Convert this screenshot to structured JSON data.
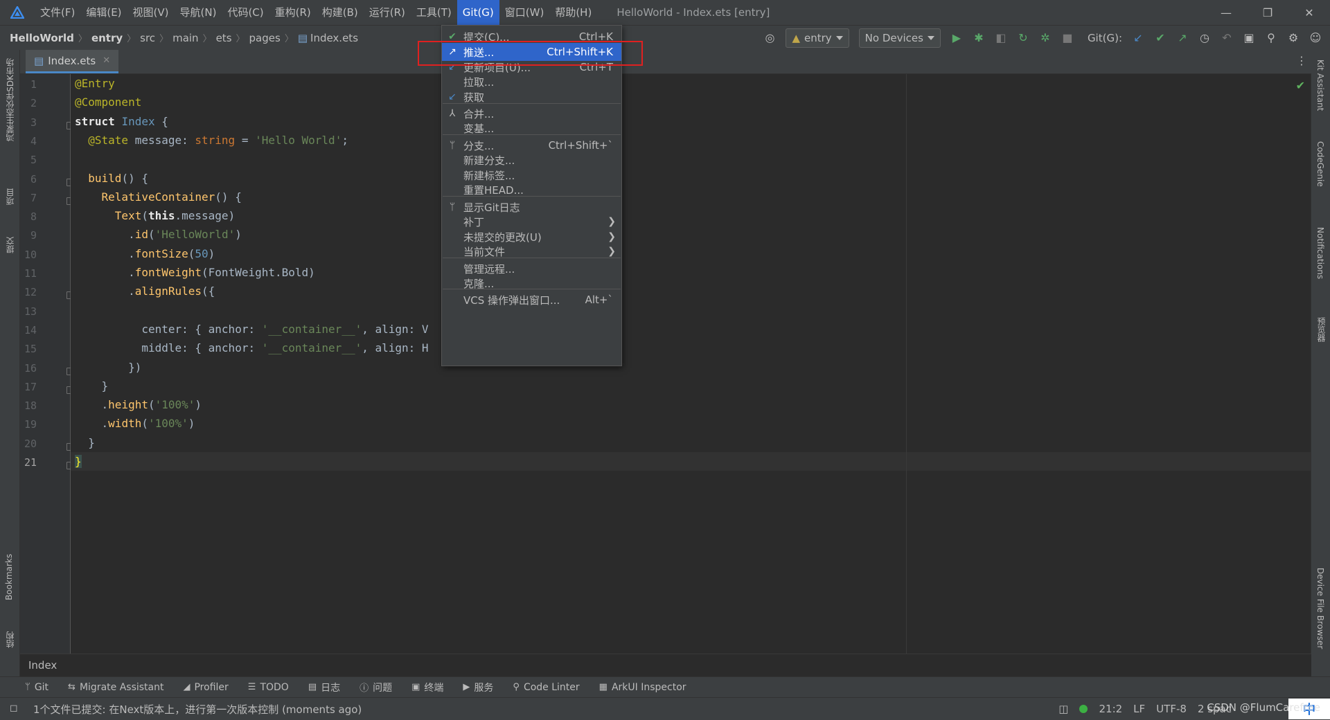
{
  "menubar": {
    "items": [
      "文件(F)",
      "编辑(E)",
      "视图(V)",
      "导航(N)",
      "代码(C)",
      "重构(R)",
      "构建(B)",
      "运行(R)",
      "工具(T)",
      "Git(G)",
      "窗口(W)",
      "帮助(H)"
    ],
    "window_title": "HelloWorld - Index.ets [entry]"
  },
  "breadcrumb": [
    "HelloWorld",
    "entry",
    "src",
    "main",
    "ets",
    "pages",
    "Index.ets"
  ],
  "toolbar": {
    "module_combo": "entry",
    "device_combo": "No Devices",
    "git_label": "Git(G):"
  },
  "tab": {
    "label": "Index.ets"
  },
  "left_stripe": {
    "labels": [
      "鸿蒙生态伙伴SDK市场",
      "项目",
      "提交",
      "Bookmarks",
      "结构"
    ]
  },
  "right_stripe": {
    "labels": [
      "Kit Assistant",
      "CodeGenie",
      "Notifications",
      "预览器",
      "Device File Browser"
    ]
  },
  "editor": {
    "line_numbers": [
      "1",
      "2",
      "3",
      "4",
      "5",
      "6",
      "7",
      "8",
      "9",
      "10",
      "11",
      "12",
      "13",
      "14",
      "15",
      "16",
      "17",
      "18",
      "19",
      "20",
      "21"
    ],
    "current_line": 21,
    "code": [
      "@Entry",
      "@Component",
      "struct Index {",
      "  @State message: string = 'Hello World';",
      "",
      "  build() {",
      "    RelativeContainer() {",
      "      Text(this.message)",
      "        .id('HelloWorld')",
      "        .fontSize(50)",
      "        .fontWeight(FontWeight.Bold)",
      "        .alignRules({",
      "",
      "          center: { anchor: '__container__', align: V",
      "          middle: { anchor: '__container__', align: H",
      "        })",
      "    }",
      "    .height('100%')",
      "    .width('100%')",
      "  }",
      "}"
    ],
    "footer_crumb": "Index"
  },
  "git_menu": {
    "items": [
      {
        "icon": "check-icon",
        "label": "提交(C)...",
        "shortcut": "Ctrl+K"
      },
      {
        "icon": "push-arrow-icon",
        "label": "推送...",
        "shortcut": "Ctrl+Shift+K",
        "selected": true
      },
      {
        "icon": "update-arrow-icon",
        "label": "更新项目(U)...",
        "shortcut": "Ctrl+T"
      },
      {
        "icon": "",
        "label": "拉取...",
        "shortcut": ""
      },
      {
        "icon": "fetch-arrow-icon",
        "label": "获取",
        "shortcut": ""
      },
      {
        "icon": "merge-icon",
        "label": "合并...",
        "shortcut": ""
      },
      {
        "icon": "",
        "label": "变基...",
        "shortcut": ""
      },
      {
        "icon": "branch-icon",
        "label": "分支...",
        "shortcut": "Ctrl+Shift+`"
      },
      {
        "icon": "",
        "label": "新建分支...",
        "shortcut": ""
      },
      {
        "icon": "",
        "label": "新建标签...",
        "shortcut": ""
      },
      {
        "icon": "",
        "label": "重置HEAD...",
        "shortcut": ""
      },
      {
        "icon": "git-log-icon",
        "label": "显示Git日志",
        "shortcut": ""
      },
      {
        "icon": "",
        "label": "补丁",
        "shortcut": "",
        "submenu": true
      },
      {
        "icon": "",
        "label": "未提交的更改(U)",
        "shortcut": "",
        "submenu": true
      },
      {
        "icon": "",
        "label": "当前文件",
        "shortcut": "",
        "submenu": true
      },
      {
        "icon": "",
        "label": "管理远程...",
        "shortcut": ""
      },
      {
        "icon": "",
        "label": "克隆...",
        "shortcut": ""
      },
      {
        "icon": "",
        "label": "VCS 操作弹出窗口...",
        "shortcut": "Alt+`"
      }
    ]
  },
  "tool_windows": [
    {
      "icon": "git-icon",
      "label": "Git"
    },
    {
      "icon": "migrate-icon",
      "label": "Migrate Assistant"
    },
    {
      "icon": "profiler-icon",
      "label": "Profiler"
    },
    {
      "icon": "todo-icon",
      "label": "TODO"
    },
    {
      "icon": "log-icon",
      "label": "日志"
    },
    {
      "icon": "problems-icon",
      "label": "问题"
    },
    {
      "icon": "terminal-icon",
      "label": "终端"
    },
    {
      "icon": "services-icon",
      "label": "服务"
    },
    {
      "icon": "linter-icon",
      "label": "Code Linter"
    },
    {
      "icon": "inspector-icon",
      "label": "ArkUI Inspector"
    }
  ],
  "statusbar": {
    "message": "1个文件已提交: 在Next版本上，进行第一次版本控制 (moments ago)",
    "position": "21:2",
    "line_sep": "LF",
    "encoding": "UTF-8",
    "indent": "2 spac",
    "ime": "中",
    "watermark": "CSDN @FlumCarefree"
  },
  "colors": {
    "accent": "#2f65ca",
    "highlight_box": "#e02020",
    "status_ok": "#3cb043"
  }
}
